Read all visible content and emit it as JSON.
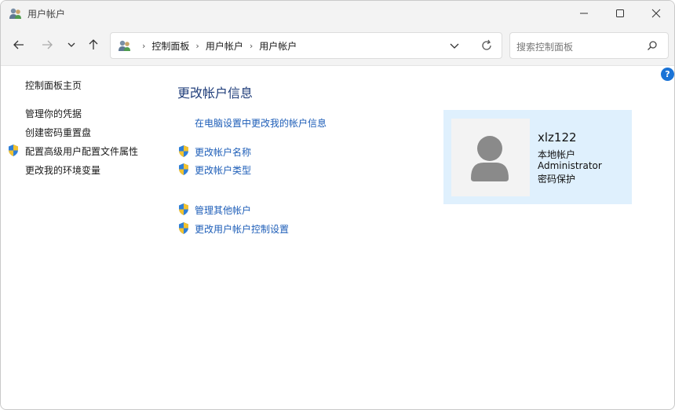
{
  "window": {
    "title": "用户帐户"
  },
  "navigation": {
    "breadcrumbs": [
      "控制面板",
      "用户帐户",
      "用户帐户"
    ],
    "search_placeholder": "搜索控制面板"
  },
  "help": {
    "label": "?"
  },
  "sidebar": {
    "home": "控制面板主页",
    "links": [
      "管理你的凭据",
      "创建密码重置盘",
      "配置高级用户配置文件属性",
      "更改我的环境变量"
    ]
  },
  "main": {
    "heading": "更改帐户信息",
    "pc_settings_link": "在电脑设置中更改我的帐户信息",
    "tasks": [
      "更改帐户名称",
      "更改帐户类型"
    ],
    "other_tasks": [
      "管理其他帐户",
      "更改用户帐户控制设置"
    ]
  },
  "account": {
    "username": "xlz122",
    "type": "本地帐户",
    "role": "Administrator",
    "protection": "密码保护"
  },
  "colors": {
    "link": "#1e5eb8",
    "heading": "#1f3d7a",
    "card_bg": "#dff0fd",
    "help": "#1a73d6"
  }
}
